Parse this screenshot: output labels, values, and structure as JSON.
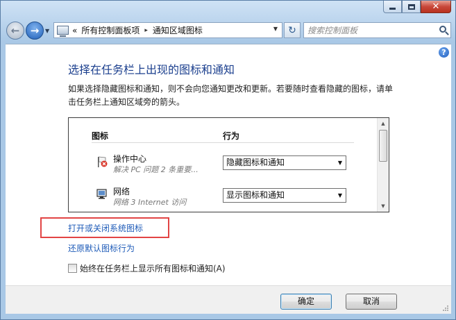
{
  "address": {
    "chevron": "«",
    "crumbs": [
      "所有控制面板项",
      "通知区域图标"
    ],
    "separator": "▸"
  },
  "search": {
    "placeholder": "搜索控制面板"
  },
  "page": {
    "title": "选择在任务栏上出现的图标和通知",
    "description": "如果选择隐藏图标和通知，则不会向您通知更改和更新。若要随时查看隐藏的图标，请单击任务栏上通知区域旁的箭头。"
  },
  "table": {
    "col_icon": "图标",
    "col_behavior": "行为",
    "rows": [
      {
        "name": "操作中心",
        "sub": "解决 PC 问题  2 条重要...",
        "behavior": "隐藏图标和通知",
        "icon": "flag-x-icon"
      },
      {
        "name": "网络",
        "sub": "网络 3 Internet 访问",
        "behavior": "显示图标和通知",
        "icon": "network-monitor-icon"
      }
    ]
  },
  "links": {
    "system_icons": "打开或关闭系统图标",
    "restore_default": "还原默认图标行为"
  },
  "checkbox": {
    "label": "始终在任务栏上显示所有图标和通知(A)",
    "checked": false
  },
  "buttons": {
    "ok": "确定",
    "cancel": "取消"
  },
  "colors": {
    "link": "#1e5bb8",
    "title": "#1b3f8e",
    "highlight": "#e24444"
  }
}
